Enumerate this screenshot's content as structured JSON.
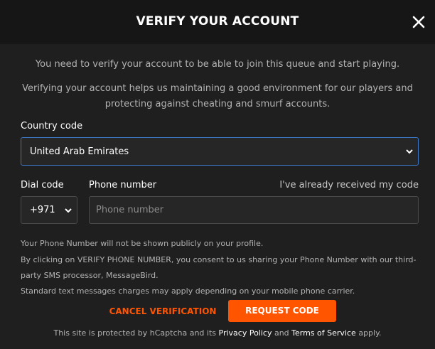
{
  "modal": {
    "title": "VERIFY YOUR ACCOUNT",
    "close_icon": "close-x-icon"
  },
  "intro": {
    "line1": "You need to verify your account to be able to join this queue and start playing.",
    "line2": "Verifying your account helps us maintaining a good environment for our players and protecting against cheating and smurf accounts."
  },
  "form": {
    "country_label": "Country code",
    "country_value": "United Arab Emirates",
    "dial_label": "Dial code",
    "dial_value": "+971",
    "phone_label": "Phone number",
    "phone_placeholder": "Phone number",
    "phone_value": "",
    "received_link": "I've already received my code"
  },
  "notices": {
    "line1": "Your Phone Number will not be shown publicly on your profile.",
    "line2": "By clicking on VERIFY PHONE NUMBER, you consent to us sharing your Phone Number with our third-party SMS processor, MessageBird.",
    "line3": "Standard text messages charges may apply depending on your mobile phone carrier."
  },
  "actions": {
    "cancel_label": "CANCEL VERIFICATION",
    "request_label": "REQUEST CODE"
  },
  "footer": {
    "prefix": "This site is protected by hCaptcha and its ",
    "privacy_link": "Privacy Policy",
    "middle": " and ",
    "terms_link": "Terms of Service",
    "suffix": " apply."
  },
  "colors": {
    "accent": "#ff5500",
    "focus_border": "#3c78c8",
    "background": "#1f1f1f",
    "header_background": "#161616"
  }
}
